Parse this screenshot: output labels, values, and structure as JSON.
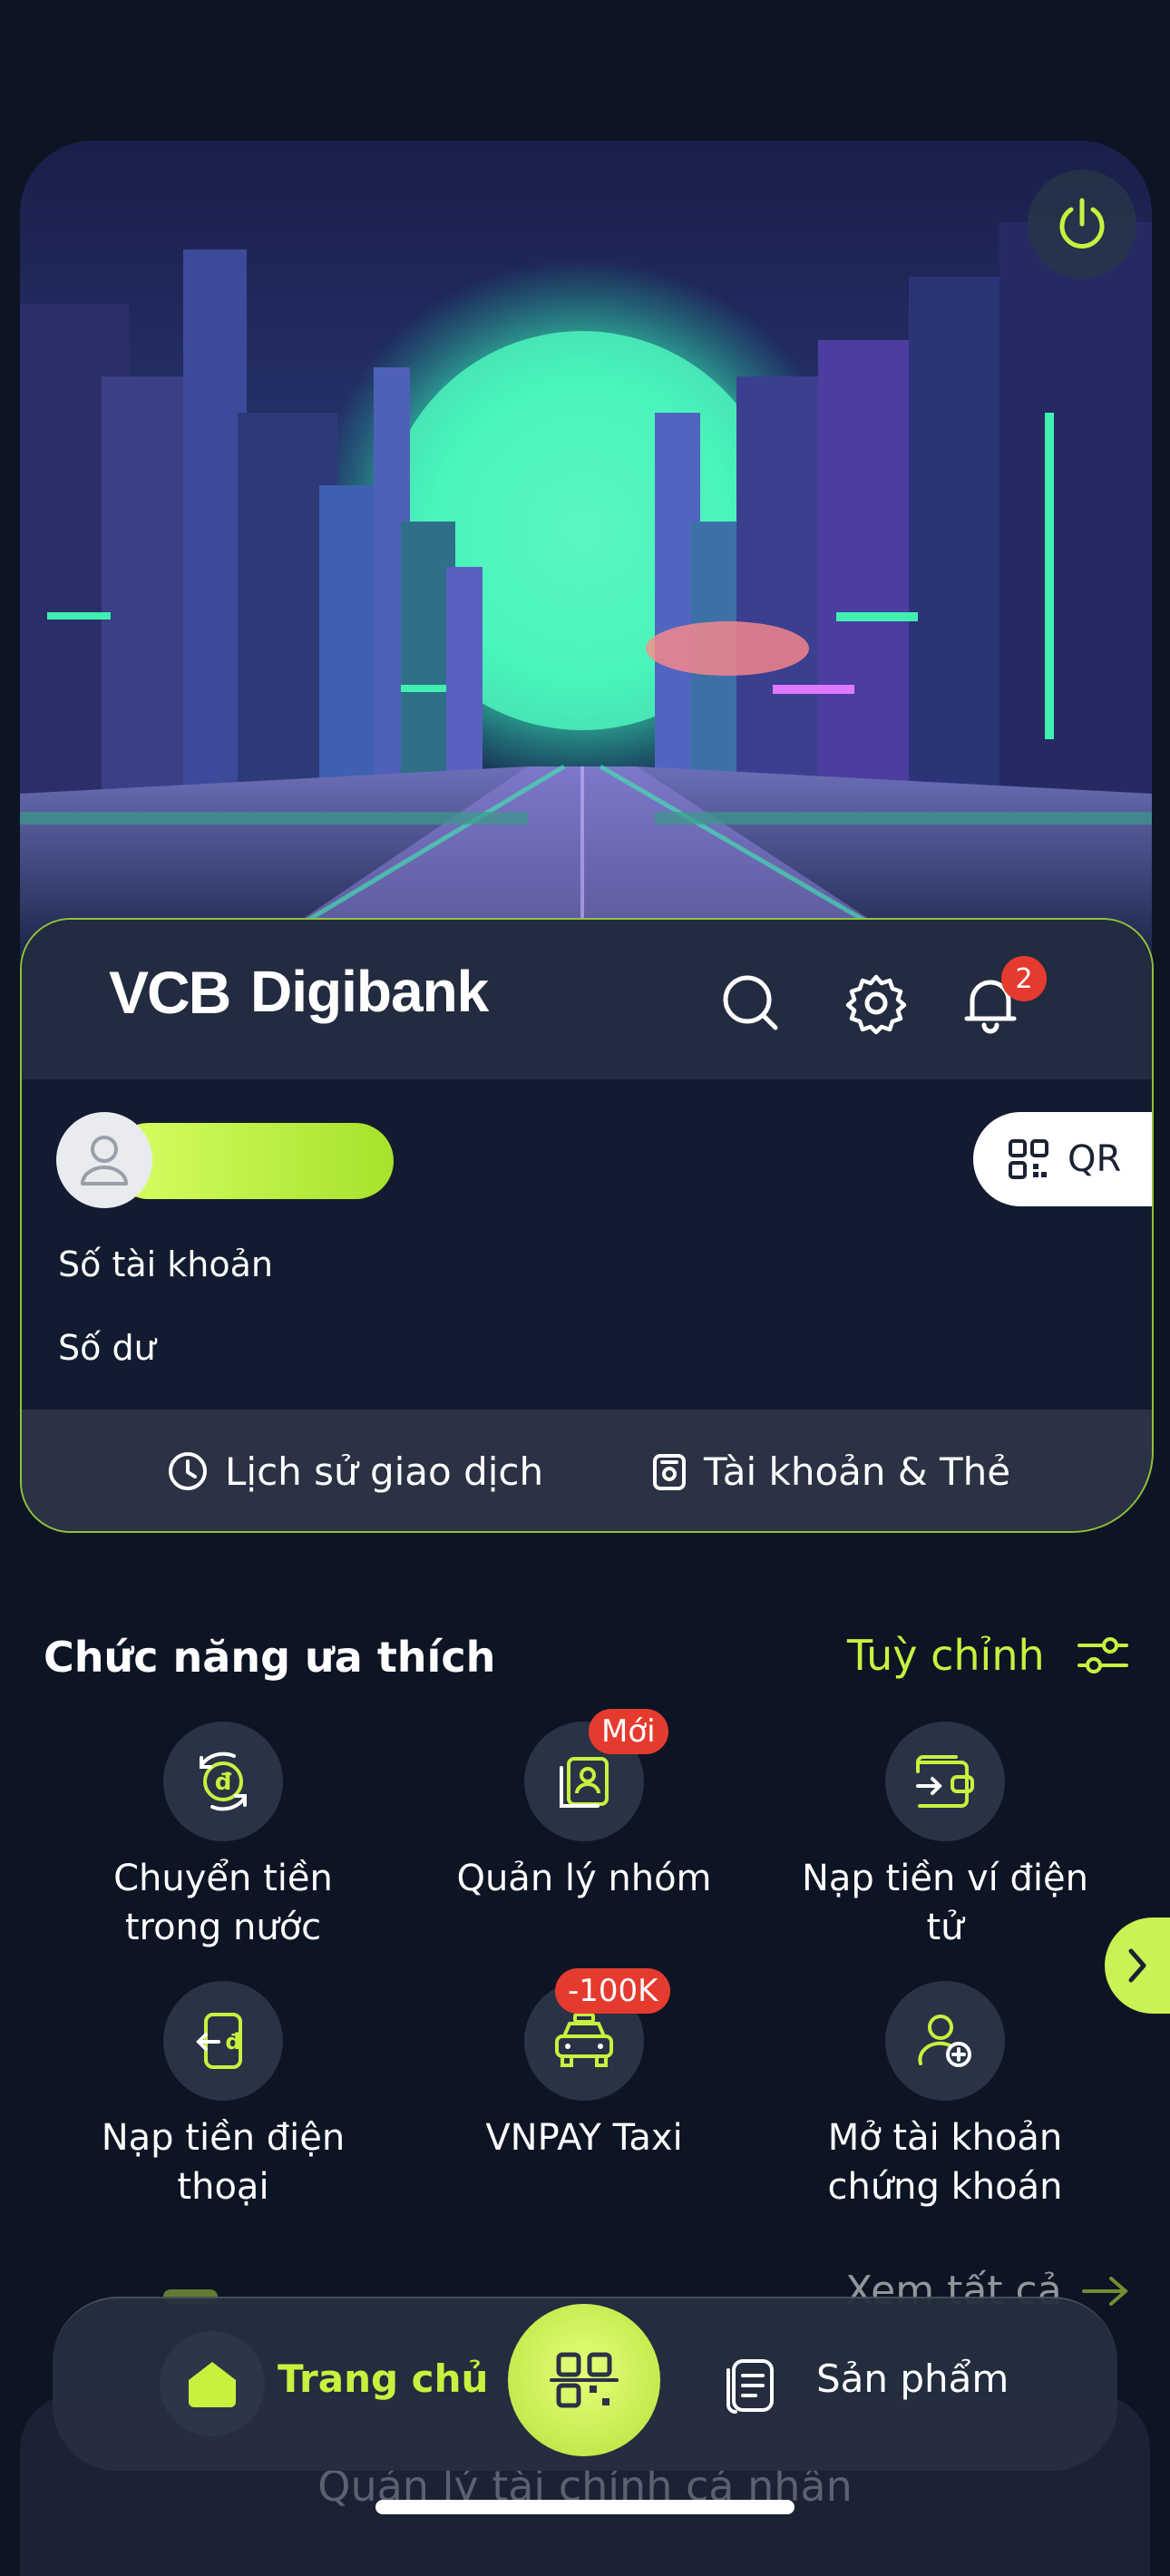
{
  "header": {
    "brand_vcb": "VCB",
    "brand_digibank": "Digibank",
    "notification_count": "2"
  },
  "account": {
    "qr_label": "QR",
    "account_number_label": "Số tài khoản",
    "balance_label": "Số dư",
    "history_label": "Lịch sử giao dịch",
    "accounts_cards_label": "Tài khoản & Thẻ"
  },
  "favorites": {
    "title": "Chức năng ưa thích",
    "customize_label": "Tuỳ chỉnh",
    "items": [
      {
        "line1": "Chuyển tiền",
        "line2": "trong nước",
        "icon": "transfer-icon",
        "badge": ""
      },
      {
        "line1": "Quản lý nhóm",
        "line2": "",
        "icon": "group-manage-icon",
        "badge": "Mới"
      },
      {
        "line1": "Nạp tiền ví điện",
        "line2": "tử",
        "icon": "wallet-topup-icon",
        "badge": ""
      },
      {
        "line1": "Nạp tiền điện",
        "line2": "thoại",
        "icon": "phone-topup-icon",
        "badge": ""
      },
      {
        "line1": "VNPAY Taxi",
        "line2": "",
        "icon": "taxi-icon",
        "badge": "-100K"
      },
      {
        "line1": "Mở tài khoản",
        "line2": "chứng khoán",
        "icon": "open-securities-icon",
        "badge": ""
      }
    ],
    "see_all_label": "Xem tất cả"
  },
  "sub_section": {
    "title": "Quản lý tài chính cá nhân"
  },
  "bottom_nav": {
    "home_label": "Trang chủ",
    "products_label": "Sản phẩm"
  },
  "colors": {
    "accent": "#c6f23f",
    "badge_red": "#e53b2f",
    "background": "#0d1424"
  }
}
